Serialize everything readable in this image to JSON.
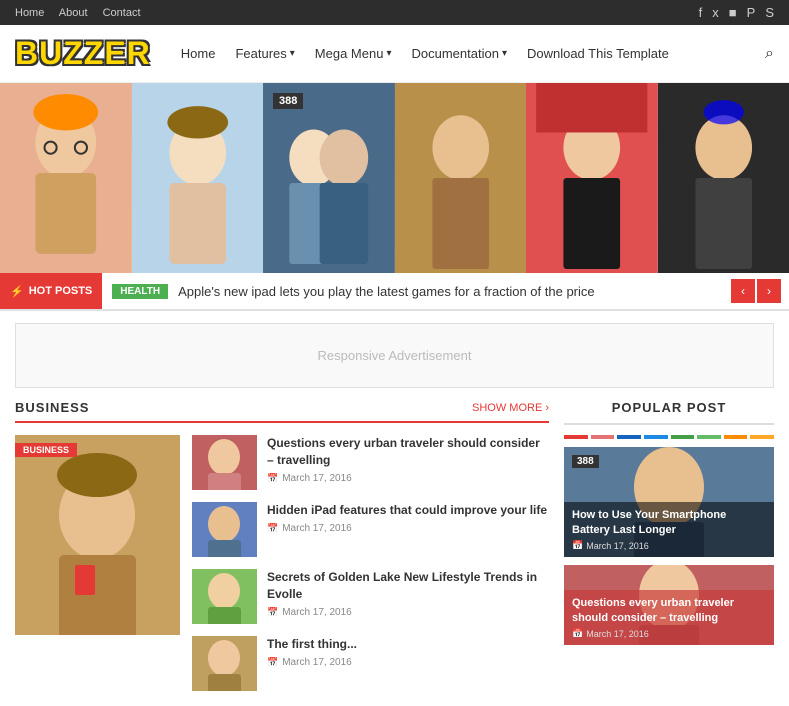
{
  "topbar": {
    "links": [
      "Home",
      "About",
      "Contact"
    ],
    "social_icons": [
      "facebook",
      "twitter",
      "instagram",
      "pinterest",
      "skype"
    ]
  },
  "header": {
    "logo": "BUZZER",
    "nav": [
      {
        "label": "Home",
        "has_dropdown": false
      },
      {
        "label": "Features",
        "has_dropdown": true
      },
      {
        "label": "Mega Menu",
        "has_dropdown": true
      },
      {
        "label": "Documentation",
        "has_dropdown": true
      },
      {
        "label": "Download This Template",
        "has_dropdown": false
      }
    ]
  },
  "ticker": {
    "hot_posts_label": "HOT POSTS",
    "health_badge": "HEALTH",
    "ticker_text": "Apple's new ipad lets you play the latest games for a fraction of the price"
  },
  "ad_banner": {
    "text": "Responsive Advertisement"
  },
  "business_section": {
    "title": "BUSINESS",
    "show_more": "SHOW MORE ›",
    "featured_badge": "BUSINESS",
    "articles": [
      {
        "title": "Questions every urban traveler should consider – travelling",
        "date": "March 17, 2016"
      },
      {
        "title": "Hidden iPad features that could improve your life",
        "date": "March 17, 2016"
      },
      {
        "title": "Secrets of Golden Lake New Lifestyle Trends in Evolle",
        "date": "March 17, 2016"
      },
      {
        "title": "The first thing...",
        "date": "March 17, 2016"
      }
    ]
  },
  "sidebar": {
    "popular_post_title": "POPULAR POST",
    "dots": [
      "#e53935",
      "#e57373",
      "#1565c0",
      "#1e88e5",
      "#43a047",
      "#66bb6a",
      "#fb8c00",
      "#ffa726"
    ],
    "featured_badge": "388",
    "posts": [
      {
        "title": "How to Use Your Smartphone Battery Last Longer",
        "date": "March 17, 2016"
      },
      {
        "title": "Questions every urban traveler should consider – travelling",
        "date": "March 17, 2016"
      }
    ]
  }
}
